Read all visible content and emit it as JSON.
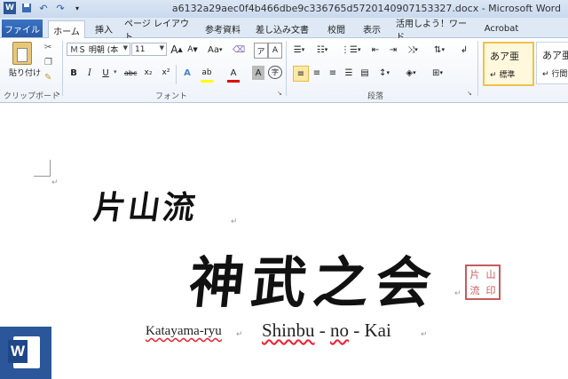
{
  "window": {
    "title": "a6132a29aec0f4b466dbe9c336765d5720140907153327.docx - Microsoft Word"
  },
  "qat": {
    "icons": [
      "word-app-icon",
      "save-icon",
      "undo-icon",
      "redo-icon",
      "customize-icon"
    ]
  },
  "tabs": {
    "file": "ファイル",
    "items": [
      "ホーム",
      "挿入",
      "ページ レイアウト",
      "参考資料",
      "差し込み文書",
      "校閲",
      "表示",
      "活用しよう！ワード",
      "Acrobat"
    ],
    "active": "ホーム"
  },
  "ribbon": {
    "clipboard": {
      "label": "クリップボード",
      "paste": "貼り付け"
    },
    "font": {
      "label": "フォント",
      "font_name": "ＭＳ 明朝 (本",
      "font_size": "11",
      "grow": "A",
      "shrink": "A",
      "case": "Aa",
      "bold": "B",
      "italic": "I",
      "underline": "U",
      "strike": "abc",
      "subscript": "x₂",
      "superscript": "x²",
      "effects": "A",
      "highlight": "ab",
      "color": "A",
      "char_shading": "A",
      "enclose": "字"
    },
    "paragraph": {
      "label": "段落"
    },
    "styles": {
      "items": [
        {
          "sample": "あア亜",
          "name": "標準",
          "active": true
        },
        {
          "sample": "あア亜",
          "name": "行間詰",
          "active": false
        }
      ]
    }
  },
  "document": {
    "line1": "片山流",
    "line2": "神武之会",
    "seal_chars": [
      "片",
      "山",
      "流",
      "印"
    ],
    "romaji_left": "Katayama-ryu",
    "romaji_right_a": "Shinbu",
    "romaji_right_b": " - ",
    "romaji_right_c": "no",
    "romaji_right_d": " - ",
    "romaji_right_e": "Kai",
    "para_mark": "↵"
  },
  "colors": {
    "titlebar": "#dbe6f4",
    "file_tab": "#2a5aa5",
    "word_logo": "#2b579a",
    "seal": "#c85a5a",
    "highlight": "#ffff00",
    "font_color": "#e00000"
  }
}
